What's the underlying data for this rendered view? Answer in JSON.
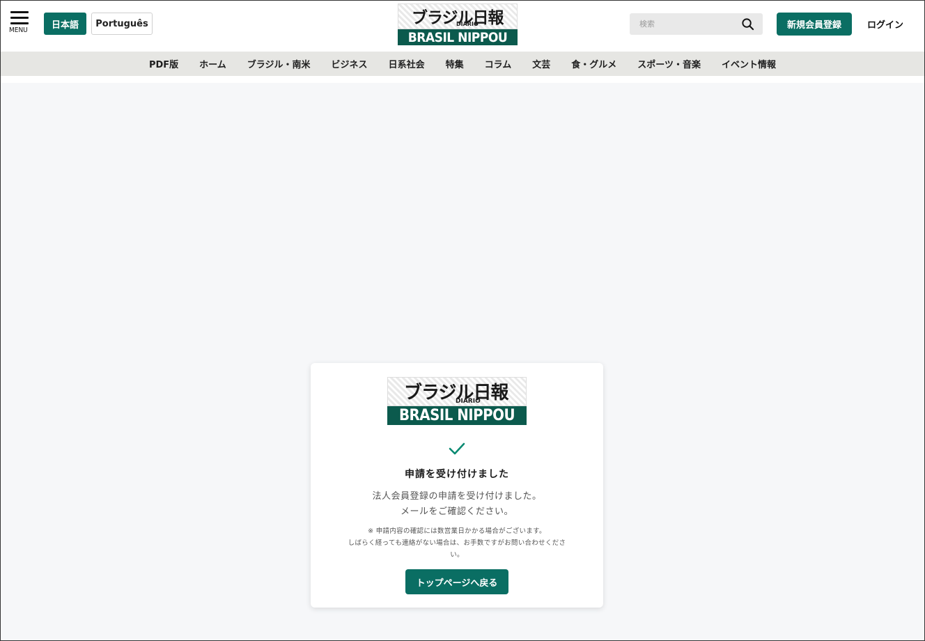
{
  "header": {
    "menu_label": "MENU",
    "lang_japanese": "日本語",
    "lang_portuguese": "Português",
    "logo": {
      "jp": "ブラジル日報",
      "diario": "DIÁRIO",
      "en": "BRASIL NIPPOU"
    },
    "search": {
      "placeholder": "検索",
      "value": ""
    },
    "register_label": "新規会員登録",
    "login_label": "ログイン"
  },
  "nav": {
    "items": [
      "PDF版",
      "ホーム",
      "ブラジル・南米",
      "ビジネス",
      "日系社会",
      "特集",
      "コラム",
      "文芸",
      "食・グルメ",
      "スポーツ・音楽",
      "イベント情報"
    ]
  },
  "card": {
    "title": "申請を受け付けました",
    "message_line1": "法人会員登録の申請を受け付けました。",
    "message_line2": "メールをご確認ください。",
    "note_line1": "※ 申請内容の確認には数営業日かかる場合がございます。",
    "note_line2": "しばらく経っても連絡がない場合は、お手数ですがお問い合わせくださ",
    "note_line3": "い。",
    "back_button_label": "トップページへ戻る"
  },
  "colors": {
    "brand_green": "#0a6e63",
    "logo_green": "#0b5a4d",
    "nav_background": "#e6e6e3",
    "page_background": "#f6f7f9",
    "check_color": "#0a8a72"
  },
  "icons": {
    "menu": "hamburger-icon",
    "search": "search-icon",
    "success": "check-icon"
  }
}
